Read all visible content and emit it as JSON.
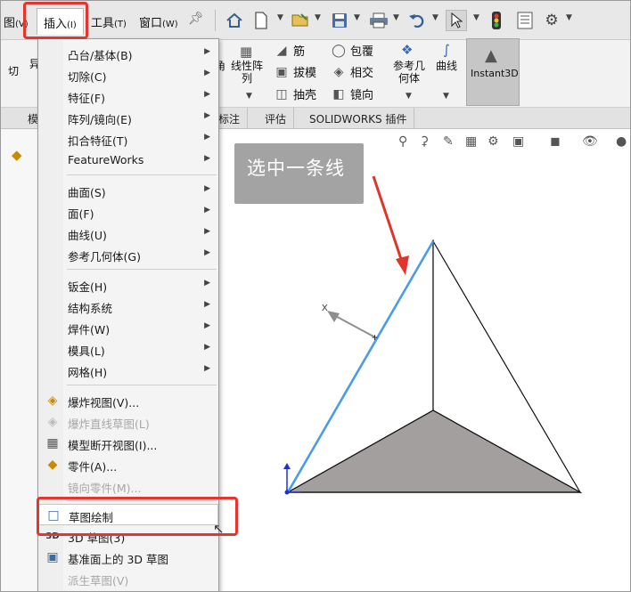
{
  "menubar": {
    "view_label": "图",
    "view_key": "(V)",
    "insert_label": "插入",
    "insert_key": "(I)",
    "tools_label": "工具",
    "tools_key": "(T)",
    "window_label": "窗口",
    "window_key": "(W)",
    "toolbar_icons": [
      "home-icon",
      "new-document-icon",
      "open-icon",
      "save-icon",
      "print-icon",
      "undo-icon",
      "select-pointer-icon",
      "traffic-light-icon",
      "file-properties-icon",
      "settings-gear-icon"
    ]
  },
  "ribbon": {
    "cut_partial": "切",
    "diff_partial": "异",
    "partial_left": "角",
    "linear_pattern": "线性阵\n列",
    "rib": "筋",
    "draft": "拔模",
    "shell": "抽壳",
    "wrap": "包覆",
    "intersect": "相交",
    "mirror": "镜向",
    "reference_geometry": "参考几\n何体",
    "curves": "曲线",
    "instant3d": "Instant3D"
  },
  "tabs": [
    "模",
    "标注",
    "评估",
    "SOLIDWORKS 插件"
  ],
  "callout": {
    "text": "选中一条线"
  },
  "scene": {
    "axis_label": "X",
    "colors": {
      "highlight_edge": "#4a9be8",
      "shaded_face": "#a49f9f",
      "arrow": "#e0352d",
      "model_edge": "#111111"
    }
  },
  "dropdown": {
    "items": [
      {
        "label": "凸台/基体(B)",
        "submenu": true,
        "enabled": true,
        "icon": ""
      },
      {
        "label": "切除(C)",
        "submenu": true,
        "enabled": true,
        "icon": ""
      },
      {
        "label": "特征(F)",
        "submenu": true,
        "enabled": true,
        "icon": ""
      },
      {
        "label": "阵列/镜向(E)",
        "submenu": true,
        "enabled": true,
        "icon": ""
      },
      {
        "label": "扣合特征(T)",
        "submenu": true,
        "enabled": true,
        "icon": ""
      },
      {
        "label": "FeatureWorks",
        "submenu": true,
        "enabled": true,
        "icon": ""
      },
      {
        "label": "曲面(S)",
        "submenu": true,
        "enabled": true,
        "icon": ""
      },
      {
        "label": "面(F)",
        "submenu": true,
        "enabled": true,
        "icon": ""
      },
      {
        "label": "曲线(U)",
        "submenu": true,
        "enabled": true,
        "icon": ""
      },
      {
        "label": "参考几何体(G)",
        "submenu": true,
        "enabled": true,
        "icon": ""
      },
      {
        "label": "钣金(H)",
        "submenu": true,
        "enabled": true,
        "icon": ""
      },
      {
        "label": "结构系统",
        "submenu": true,
        "enabled": true,
        "icon": ""
      },
      {
        "label": "焊件(W)",
        "submenu": true,
        "enabled": true,
        "icon": ""
      },
      {
        "label": "模具(L)",
        "submenu": true,
        "enabled": true,
        "icon": ""
      },
      {
        "label": "网格(H)",
        "submenu": true,
        "enabled": true,
        "icon": ""
      },
      {
        "label": "爆炸视图(V)...",
        "submenu": false,
        "enabled": true,
        "icon": "explode-view-icon"
      },
      {
        "label": "爆炸直线草图(L)",
        "submenu": false,
        "enabled": false,
        "icon": "explode-line-sketch-icon"
      },
      {
        "label": "模型断开视图(I)...",
        "submenu": false,
        "enabled": true,
        "icon": "model-break-view-icon"
      },
      {
        "label": "零件(A)...",
        "submenu": false,
        "enabled": true,
        "icon": "part-icon"
      },
      {
        "label": "镜向零件(M)...",
        "submenu": false,
        "enabled": false,
        "icon": ""
      },
      {
        "label": "草图绘制",
        "submenu": false,
        "enabled": true,
        "icon": "sketch-icon"
      },
      {
        "label": "3D 草图(3)",
        "submenu": false,
        "enabled": true,
        "icon": "3d-sketch-icon"
      },
      {
        "label": "基准面上的 3D 草图",
        "submenu": false,
        "enabled": true,
        "icon": "3d-sketch-on-plane-icon"
      },
      {
        "label": "派生草图(V)",
        "submenu": false,
        "enabled": false,
        "icon": ""
      }
    ]
  }
}
